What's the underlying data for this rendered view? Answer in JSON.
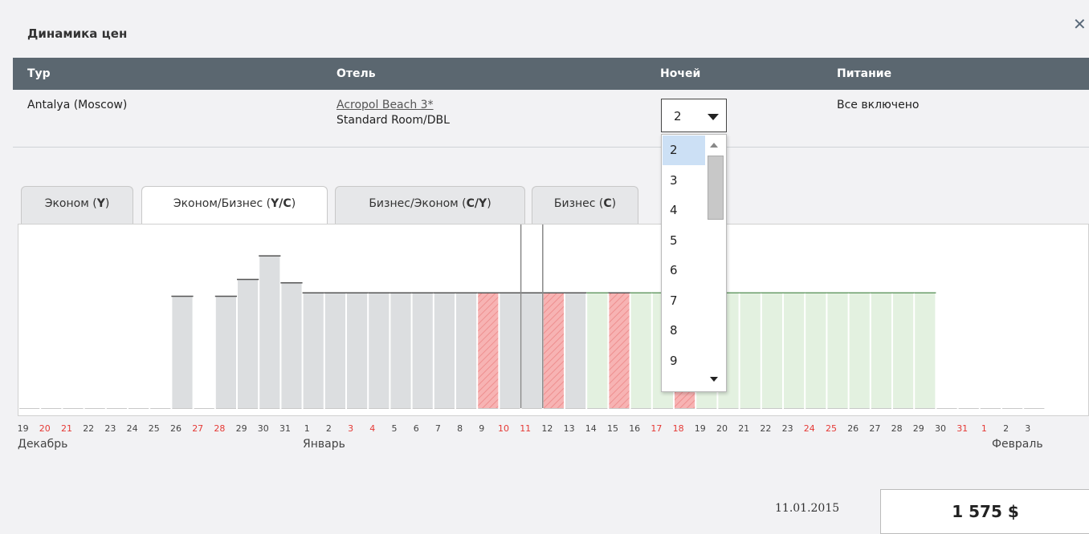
{
  "dialog": {
    "title": "Динамика цен"
  },
  "table": {
    "headers": [
      "Тур",
      "Отель",
      "Ночей",
      "Питание"
    ],
    "row": {
      "tour": "Antalya (Moscow)",
      "hotel_name": "Acropol Beach 3*",
      "room": "Standard Room/DBL",
      "nights": "2",
      "meal": "Все включено"
    }
  },
  "nights_dropdown": {
    "options": [
      "2",
      "3",
      "4",
      "5",
      "6",
      "7",
      "8",
      "9"
    ],
    "selected": "2"
  },
  "tabs": [
    {
      "label": "Эконом (",
      "code": "Y",
      "active": false
    },
    {
      "label": "Эконом/Бизнес (",
      "code": "Y/C",
      "active": true
    },
    {
      "label": "Бизнес/Эконом (",
      "code": "C/Y",
      "active": false
    },
    {
      "label": "Бизнес (",
      "code": "C",
      "active": false
    }
  ],
  "tab_close_paren": ")",
  "colors": {
    "bar": "#dcdee0",
    "weekend_day": "#e53935",
    "hatch": "#f5a3a3",
    "green_bg": "#e3f1e0",
    "header_bg": "#5b6770"
  },
  "chart_data": {
    "type": "bar",
    "months": [
      "Декабрь",
      "Январь",
      "Февраль"
    ],
    "days": [
      "19",
      "20",
      "21",
      "22",
      "23",
      "24",
      "25",
      "26",
      "27",
      "28",
      "29",
      "30",
      "31",
      "1",
      "2",
      "3",
      "4",
      "5",
      "6",
      "7",
      "8",
      "9",
      "10",
      "11",
      "12",
      "13",
      "14",
      "15",
      "16",
      "17",
      "18",
      "19",
      "20",
      "21",
      "22",
      "23",
      "24",
      "25",
      "26",
      "27",
      "28",
      "29",
      "30",
      "31",
      "1",
      "2",
      "3"
    ],
    "red_days_index": [
      1,
      2,
      8,
      9,
      15,
      16,
      22,
      23,
      29,
      30,
      36,
      37,
      43,
      44
    ],
    "values": [
      0,
      0,
      0,
      0,
      0,
      0,
      0,
      1.0,
      0,
      1.0,
      1.15,
      1.36,
      1.12,
      1.03,
      1.03,
      1.03,
      1.03,
      1.03,
      1.03,
      1.03,
      1.03,
      1.03,
      1.03,
      1.03,
      1.03,
      1.03,
      1.03,
      1.03,
      1.03,
      1.03,
      1.03,
      1.03,
      1.03,
      1.03,
      1.03,
      1.03,
      1.03,
      1.03,
      1.03,
      1.03,
      1.03,
      1.03,
      0,
      0,
      0,
      0,
      0
    ],
    "bar_style": [
      "none",
      "none",
      "none",
      "none",
      "none",
      "none",
      "none",
      "grey",
      "none",
      "grey",
      "grey",
      "grey",
      "grey",
      "grey",
      "grey",
      "grey",
      "grey",
      "grey",
      "grey",
      "grey",
      "grey",
      "hatch",
      "grey",
      "grey",
      "hatch",
      "grey",
      "green",
      "hatch",
      "green",
      "green",
      "hatch",
      "green",
      "green",
      "green",
      "green",
      "green",
      "green",
      "green",
      "green",
      "green",
      "green",
      "green",
      "none",
      "none",
      "none",
      "none",
      "none"
    ],
    "selected_day_index": 23
  },
  "selection": {
    "date": "11.01.2015",
    "price": "1 575 $"
  }
}
